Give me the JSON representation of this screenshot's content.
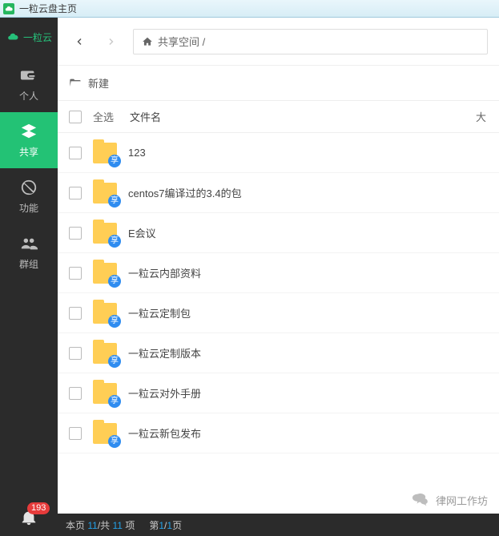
{
  "window": {
    "title": "一粒云盘主页"
  },
  "brand": {
    "text": "一粒云"
  },
  "sidebar": {
    "items": [
      {
        "label": "个人",
        "icon": "wallet-icon"
      },
      {
        "label": "共享",
        "icon": "layers-icon",
        "active": true
      },
      {
        "label": "功能",
        "icon": "forbid-icon"
      },
      {
        "label": "群组",
        "icon": "people-icon"
      }
    ],
    "badge": "193"
  },
  "nav": {
    "breadcrumb": "共享空间 /"
  },
  "toolbar": {
    "new_label": "新建"
  },
  "columns": {
    "select_all": "全选",
    "filename": "文件名",
    "size": "大"
  },
  "files": [
    {
      "name": "123"
    },
    {
      "name": "centos7编译过的3.4的包"
    },
    {
      "name": "E会议"
    },
    {
      "name": "一粒云内部资料"
    },
    {
      "name": "一粒云定制包"
    },
    {
      "name": "一粒云定制版本"
    },
    {
      "name": "一粒云对外手册"
    },
    {
      "name": "一粒云新包发布"
    }
  ],
  "share_glyph": "享",
  "status": {
    "prefix": "本页",
    "page_shown": "11",
    "sep": "/共",
    "total": "11",
    "items_suffix": "项",
    "page_label_prefix": "第",
    "page_current": "1",
    "page_sep": "/",
    "page_total": "1",
    "page_label_suffix": "页"
  },
  "watermark": {
    "text": "律网工作坊"
  }
}
